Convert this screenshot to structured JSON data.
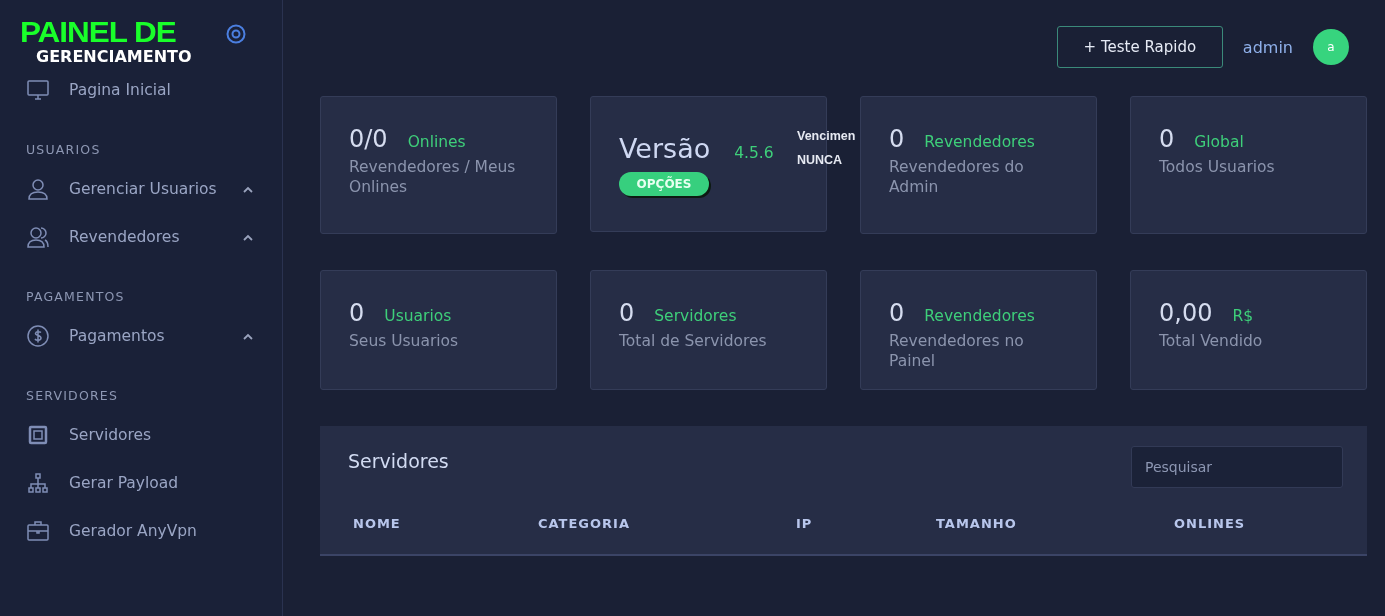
{
  "logo": {
    "line_1": "PAINEL DE",
    "line_2": "GERENCIAMENTO"
  },
  "sidebar": {
    "items": [
      {
        "kind": "link",
        "label": "Pagina Inicial",
        "has_submenu": false
      },
      {
        "kind": "heading",
        "label": "USUARIOS"
      },
      {
        "kind": "link",
        "label": "Gerenciar Usuarios",
        "has_submenu": true
      },
      {
        "kind": "link",
        "label": "Revendedores",
        "has_submenu": true
      },
      {
        "kind": "heading",
        "label": "PAGAMENTOS"
      },
      {
        "kind": "link",
        "label": "Pagamentos",
        "has_submenu": true
      },
      {
        "kind": "heading",
        "label": "SERVIDORES"
      },
      {
        "kind": "link",
        "label": "Servidores",
        "has_submenu": false
      },
      {
        "kind": "link",
        "label": "Gerar Payload",
        "has_submenu": false
      },
      {
        "kind": "link",
        "label": "Gerador AnyVpn",
        "has_submenu": false
      }
    ]
  },
  "header": {
    "button": "+ Teste Rapido",
    "user": "admin",
    "avatar": "a"
  },
  "cards": [
    {
      "kind": "stat",
      "value": "0/0",
      "tag": "Onlines",
      "subtitle": "Revendedores / Meus Onlines"
    },
    {
      "kind": "version",
      "value": "Versão",
      "tag": "4.5.6",
      "button": "OPÇÕES",
      "expiry_label": "Vencimen",
      "expiry_value": "NUNCA"
    },
    {
      "kind": "stat",
      "value": "0",
      "tag": "Revendedores",
      "subtitle": "Revendedores do Admin"
    },
    {
      "kind": "stat",
      "value": "0",
      "tag": "Global",
      "subtitle": "Todos Usuarios"
    },
    {
      "kind": "stat",
      "value": "0",
      "tag": "Usuarios",
      "subtitle": "Seus Usuarios"
    },
    {
      "kind": "stat",
      "value": "0",
      "tag": "Servidores",
      "subtitle": "Total de Servidores"
    },
    {
      "kind": "stat",
      "value": "0",
      "tag": "Revendedores",
      "subtitle": "Revendedores no Painel"
    },
    {
      "kind": "stat",
      "value": "0,00",
      "tag": "R$",
      "subtitle": "Total Vendido"
    }
  ],
  "table": {
    "title": "Servidores",
    "search": {
      "placeholder": "Pesquisar"
    },
    "columns": [
      "NOME",
      "CATEGORIA",
      "IP",
      "TAMANHO",
      "ONLINES"
    ]
  }
}
